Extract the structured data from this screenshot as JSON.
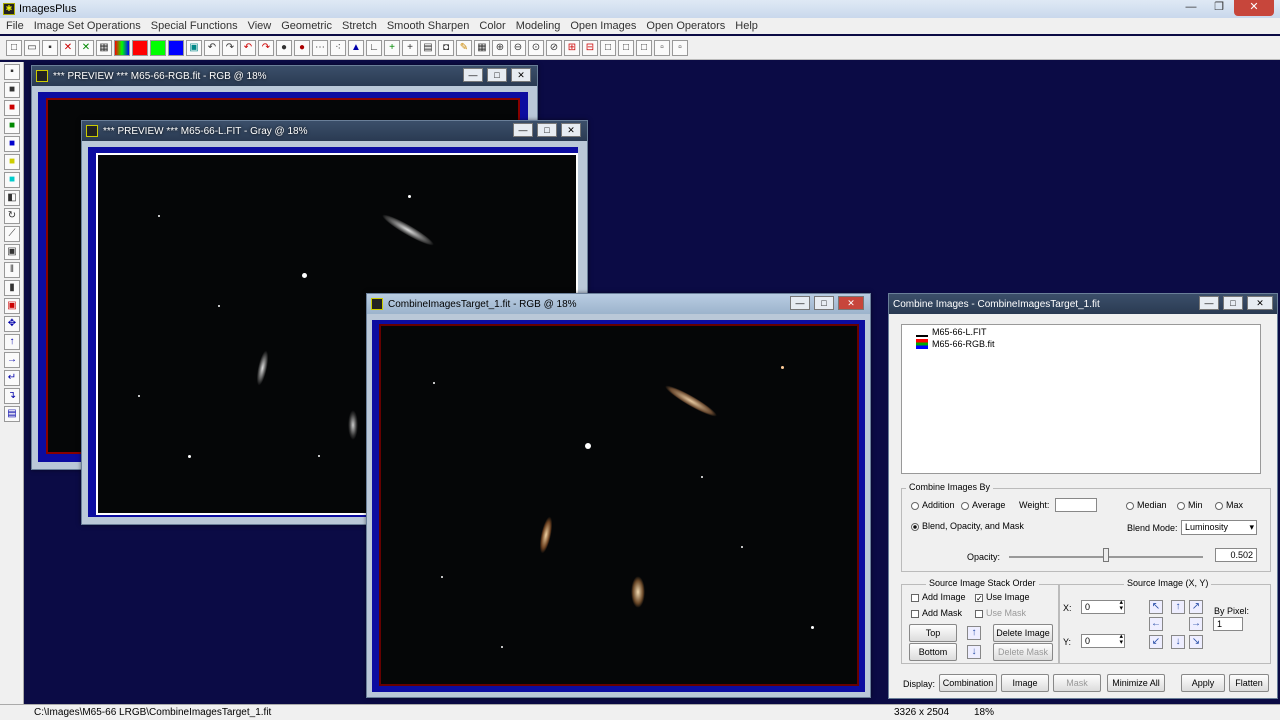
{
  "app": {
    "title": "ImagesPlus"
  },
  "menu": [
    "File",
    "Image Set Operations",
    "Special Functions",
    "View",
    "Geometric",
    "Stretch",
    "Smooth Sharpen",
    "Color",
    "Modeling",
    "Open Images",
    "Open Operators",
    "Help"
  ],
  "windows": {
    "preview_rgb": {
      "title": "*** PREVIEW *** M65-66-RGB.fit - RGB @ 18%"
    },
    "preview_gray": {
      "title": "*** PREVIEW *** M65-66-L.FIT - Gray @ 18%"
    },
    "target": {
      "title": "CombineImagesTarget_1.fit - RGB @ 18%"
    }
  },
  "panel": {
    "title": "Combine Images - CombineImagesTarget_1.fit",
    "list": [
      "M65-66-L.FIT",
      "M65-66-RGB.fit"
    ],
    "combine_group": "Combine Images By",
    "addition": "Addition",
    "average": "Average",
    "weight": "Weight:",
    "median": "Median",
    "min": "Min",
    "max": "Max",
    "blend": "Blend, Opacity, and Mask",
    "blend_mode_label": "Blend Mode:",
    "blend_mode": "Luminosity",
    "opacity_label": "Opacity:",
    "opacity": "0.502",
    "stack_group": "Source Image Stack Order",
    "add_image": "Add Image",
    "use_image": "Use Image",
    "add_mask": "Add Mask",
    "use_mask": "Use Mask",
    "top": "Top",
    "bottom": "Bottom",
    "delete_image": "Delete Image",
    "delete_mask": "Delete Mask",
    "source_group": "Source Image (X, Y)",
    "x_label": "X:",
    "y_label": "Y:",
    "x": "0",
    "y": "0",
    "by_pixel": "By Pixel:",
    "by_pixel_value": "1",
    "display": "Display:",
    "combination": "Combination",
    "image": "Image",
    "mask": "Mask",
    "minimize_all": "Minimize All",
    "apply": "Apply",
    "flatten": "Flatten"
  },
  "status": {
    "path": "C:\\Images\\M65-66 LRGB\\CombineImagesTarget_1.fit",
    "size": "3326 x 2504",
    "zoom": "18%"
  }
}
